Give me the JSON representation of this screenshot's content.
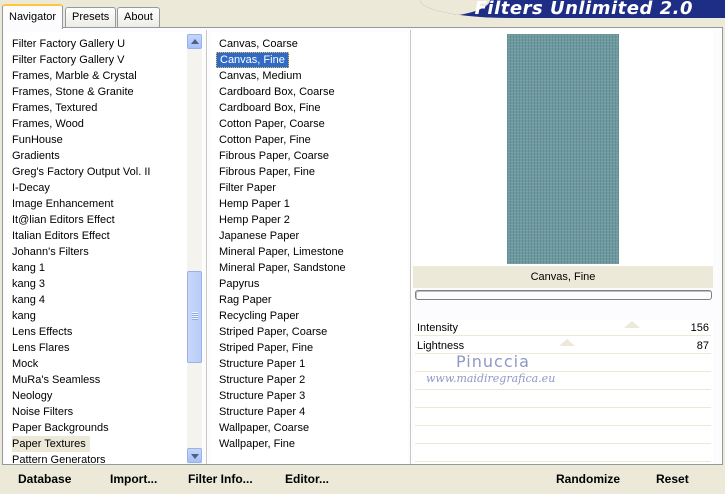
{
  "tabs": [
    "Navigator",
    "Presets",
    "About"
  ],
  "banner": {
    "title": "Filters Unlimited 2.0"
  },
  "categories": [
    "Filter Factory Gallery U",
    "Filter Factory Gallery V",
    "Frames, Marble & Crystal",
    "Frames, Stone & Granite",
    "Frames, Textured",
    "Frames, Wood",
    "FunHouse",
    "Gradients",
    "Greg's Factory Output Vol. II",
    "I-Decay",
    "Image Enhancement",
    "It@lian Editors Effect",
    "Italian Editors Effect",
    "Johann's Filters",
    "kang 1",
    "kang 3",
    "kang 4",
    "kang",
    "Lens Effects",
    "Lens Flares",
    "Mock",
    "MuRa's Seamless",
    "Neology",
    "Noise Filters",
    "Paper Backgrounds",
    "Paper Textures",
    "Pattern Generators"
  ],
  "selected_category": "Paper Textures",
  "filters": [
    "Canvas, Coarse",
    "Canvas, Fine",
    "Canvas, Medium",
    "Cardboard Box, Coarse",
    "Cardboard Box, Fine",
    "Cotton Paper, Coarse",
    "Cotton Paper, Fine",
    "Fibrous Paper, Coarse",
    "Fibrous Paper, Fine",
    "Filter Paper",
    "Hemp Paper 1",
    "Hemp Paper 2",
    "Japanese Paper",
    "Mineral Paper, Limestone",
    "Mineral Paper, Sandstone",
    "Papyrus",
    "Rag Paper",
    "Recycling Paper",
    "Striped Paper, Coarse",
    "Striped Paper, Fine",
    "Structure Paper 1",
    "Structure Paper 2",
    "Structure Paper 3",
    "Structure Paper 4",
    "Wallpaper, Coarse",
    "Wallpaper, Fine"
  ],
  "selected_filter": "Canvas, Fine",
  "preview": {
    "filter_name": "Canvas, Fine",
    "texture_color": "#6d9aa0"
  },
  "sliders": [
    {
      "label": "Intensity",
      "value": "156",
      "fraction": 0.612
    },
    {
      "label": "Lightness",
      "value": "87",
      "fraction": 0.341
    }
  ],
  "watermark": {
    "line1": "Pinuccia",
    "line2": "www.maidiregrafica.eu"
  },
  "buttons": {
    "database": "Database",
    "import": "Import...",
    "filter_info": "Filter Info...",
    "editor": "Editor...",
    "randomize": "Randomize",
    "reset": "Reset"
  },
  "colors": {
    "selection": "#316ac5",
    "banner": "#1e2e86",
    "panel": "#ece9d8"
  }
}
